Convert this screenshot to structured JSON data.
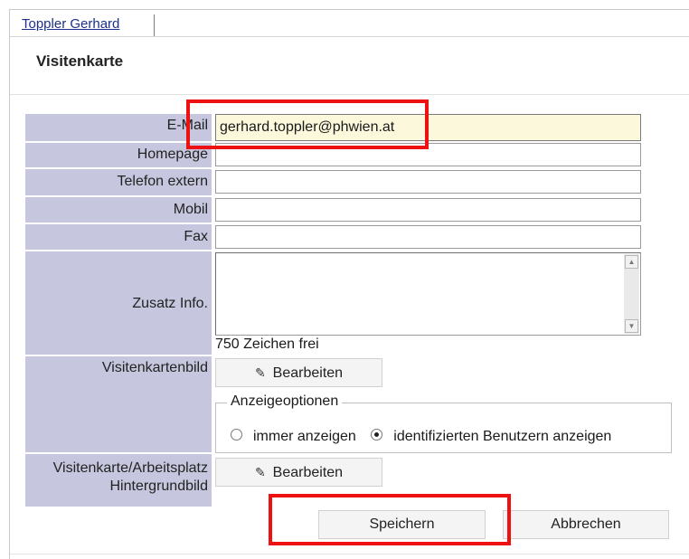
{
  "tabs": {
    "active": "Toppler Gerhard"
  },
  "page": {
    "title": "Visitenkarte"
  },
  "form": {
    "email": {
      "label": "E-Mail",
      "value": "gerhard.toppler@phwien.at"
    },
    "homepage": {
      "label": "Homepage",
      "value": ""
    },
    "telefon": {
      "label": "Telefon extern",
      "value": ""
    },
    "mobil": {
      "label": "Mobil",
      "value": ""
    },
    "fax": {
      "label": "Fax",
      "value": ""
    },
    "zusatz": {
      "label": "Zusatz Info.",
      "value": "",
      "counter": "750 Zeichen frei"
    },
    "bild": {
      "label": "Visitenkartenbild",
      "button": "Bearbeiten"
    },
    "anzeige": {
      "legend": "Anzeigeoptionen",
      "options": [
        {
          "label": "immer anzeigen",
          "checked": false
        },
        {
          "label": "identifizierten Benutzern anzeigen",
          "checked": true
        }
      ]
    },
    "hintergrund": {
      "label_line1": "Visitenkarte/Arbeitsplatz",
      "label_line2": "Hintergrundbild",
      "button": "Bearbeiten"
    }
  },
  "actions": {
    "save": "Speichern",
    "cancel": "Abbrechen"
  },
  "icons": {
    "edit": "pencil-icon"
  },
  "colors": {
    "label_bg": "#c6c7de",
    "active_input_bg": "#fbf8db",
    "highlight": "#ee1111",
    "link": "#1b2f8c"
  }
}
